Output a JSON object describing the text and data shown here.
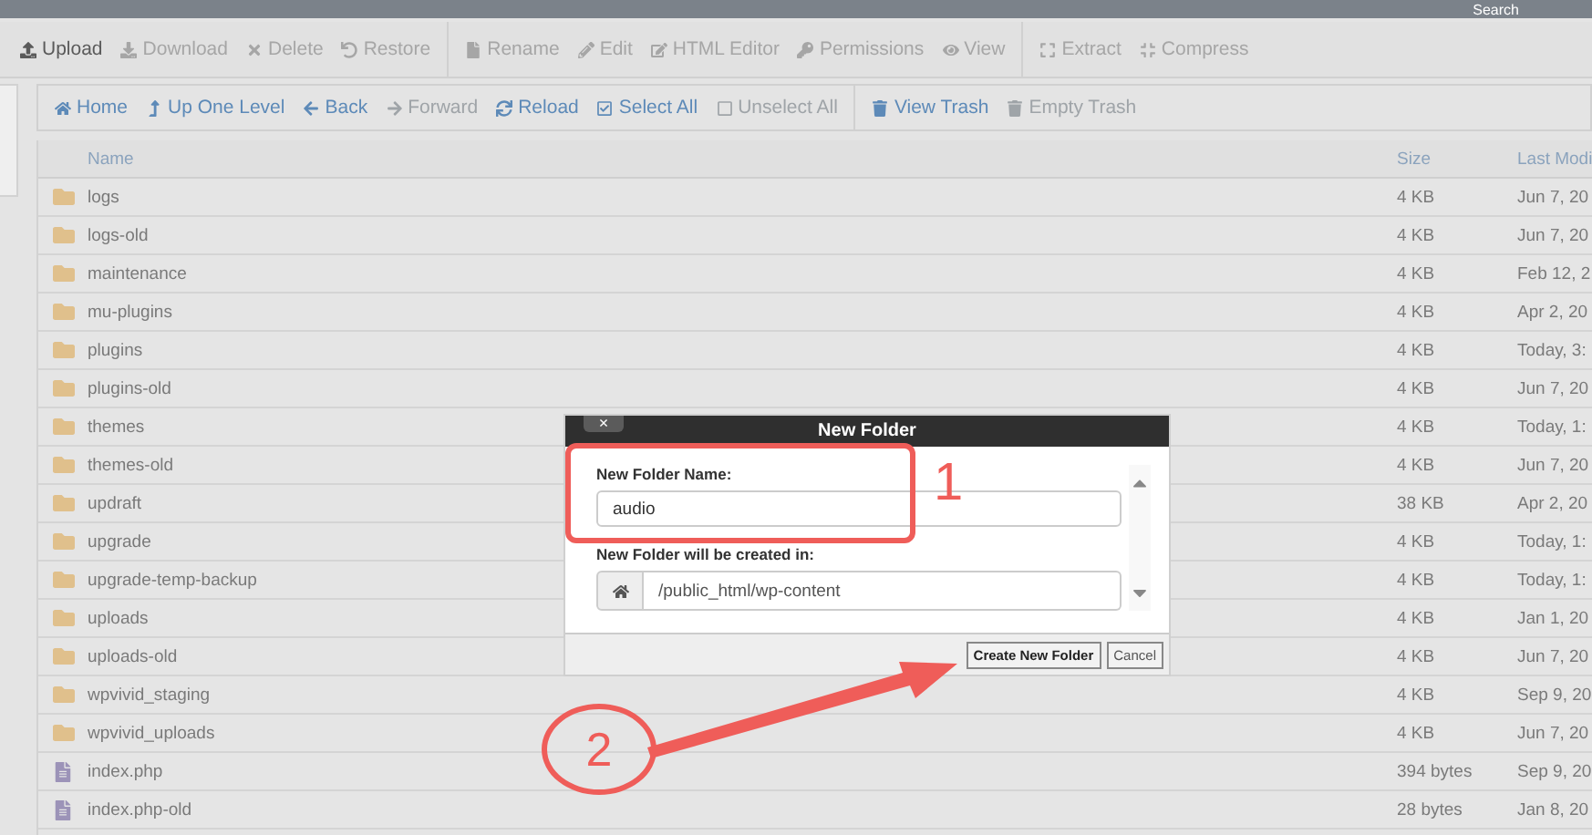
{
  "top_bar": {
    "search_label": "Search"
  },
  "toolbar_groups": [
    {
      "items": [
        {
          "kind": "upload",
          "label": "Upload",
          "disabled": false
        },
        {
          "kind": "download",
          "label": "Download",
          "disabled": true
        },
        {
          "kind": "delete",
          "label": "Delete",
          "disabled": true
        },
        {
          "kind": "restore",
          "label": "Restore",
          "disabled": true
        }
      ]
    },
    {
      "items": [
        {
          "kind": "rename",
          "label": "Rename",
          "disabled": true
        },
        {
          "kind": "edit",
          "label": "Edit",
          "disabled": true
        },
        {
          "kind": "editor",
          "label": "HTML Editor",
          "disabled": true
        },
        {
          "kind": "permissions",
          "label": "Permissions",
          "disabled": true
        },
        {
          "kind": "view",
          "label": "View",
          "disabled": true
        }
      ]
    },
    {
      "items": [
        {
          "kind": "extract",
          "label": "Extract",
          "disabled": true
        },
        {
          "kind": "compress",
          "label": "Compress",
          "disabled": true
        }
      ]
    }
  ],
  "nav_groups": [
    {
      "items": [
        {
          "kind": "home",
          "label": "Home",
          "disabled": false
        },
        {
          "kind": "up",
          "label": "Up One Level",
          "disabled": false
        },
        {
          "kind": "back",
          "label": "Back",
          "disabled": false
        },
        {
          "kind": "forward",
          "label": "Forward",
          "disabled": true
        },
        {
          "kind": "reload",
          "label": "Reload",
          "disabled": false
        },
        {
          "kind": "select",
          "label": "Select All",
          "disabled": false
        },
        {
          "kind": "unselect",
          "label": "Unselect All",
          "disabled": true
        }
      ]
    },
    {
      "items": [
        {
          "kind": "trash",
          "label": "View Trash",
          "disabled": false
        },
        {
          "kind": "trash",
          "label": "Empty Trash",
          "disabled": true
        }
      ]
    }
  ],
  "table": {
    "columns": [
      "Name",
      "Size",
      "Last Modi"
    ],
    "rows": [
      {
        "kind": "folder",
        "name": "logs",
        "size": "4 KB",
        "modified": "Jun 7, 20"
      },
      {
        "kind": "folder",
        "name": "logs-old",
        "size": "4 KB",
        "modified": "Jun 7, 20"
      },
      {
        "kind": "folder",
        "name": "maintenance",
        "size": "4 KB",
        "modified": "Feb 12, 2"
      },
      {
        "kind": "folder",
        "name": "mu-plugins",
        "size": "4 KB",
        "modified": "Apr 2, 20"
      },
      {
        "kind": "folder",
        "name": "plugins",
        "size": "4 KB",
        "modified": "Today, 3:"
      },
      {
        "kind": "folder",
        "name": "plugins-old",
        "size": "4 KB",
        "modified": "Jun 7, 20"
      },
      {
        "kind": "folder",
        "name": "themes",
        "size": "4 KB",
        "modified": "Today, 1:"
      },
      {
        "kind": "folder",
        "name": "themes-old",
        "size": "4 KB",
        "modified": "Jun 7, 20"
      },
      {
        "kind": "folder",
        "name": "updraft",
        "size": "38 KB",
        "modified": "Apr 2, 20"
      },
      {
        "kind": "folder",
        "name": "upgrade",
        "size": "4 KB",
        "modified": "Today, 1:"
      },
      {
        "kind": "folder",
        "name": "upgrade-temp-backup",
        "size": "4 KB",
        "modified": "Today, 1:"
      },
      {
        "kind": "folder",
        "name": "uploads",
        "size": "4 KB",
        "modified": "Jan 1, 20"
      },
      {
        "kind": "folder",
        "name": "uploads-old",
        "size": "4 KB",
        "modified": "Jun 7, 20"
      },
      {
        "kind": "folder",
        "name": "wpvivid_staging",
        "size": "4 KB",
        "modified": "Sep 9, 20"
      },
      {
        "kind": "folder",
        "name": "wpvivid_uploads",
        "size": "4 KB",
        "modified": "Jun 7, 20"
      },
      {
        "kind": "file",
        "name": "index.php",
        "size": "394 bytes",
        "modified": "Sep 9, 20"
      },
      {
        "kind": "file",
        "name": "index.php-old",
        "size": "28 bytes",
        "modified": "Jan 8, 20"
      }
    ]
  },
  "dialog": {
    "title": "New Folder",
    "close_label": "×",
    "name_label": "New Folder Name:",
    "name_value": "audio",
    "location_label": "New Folder will be created in:",
    "location_value": "/public_html/wp-content",
    "buttons": [
      {
        "label": "Create New Folder",
        "kind": "primary"
      },
      {
        "label": "Cancel",
        "kind": "secondary"
      }
    ]
  },
  "annotations": {
    "step_1": "1",
    "step_2": "2"
  }
}
